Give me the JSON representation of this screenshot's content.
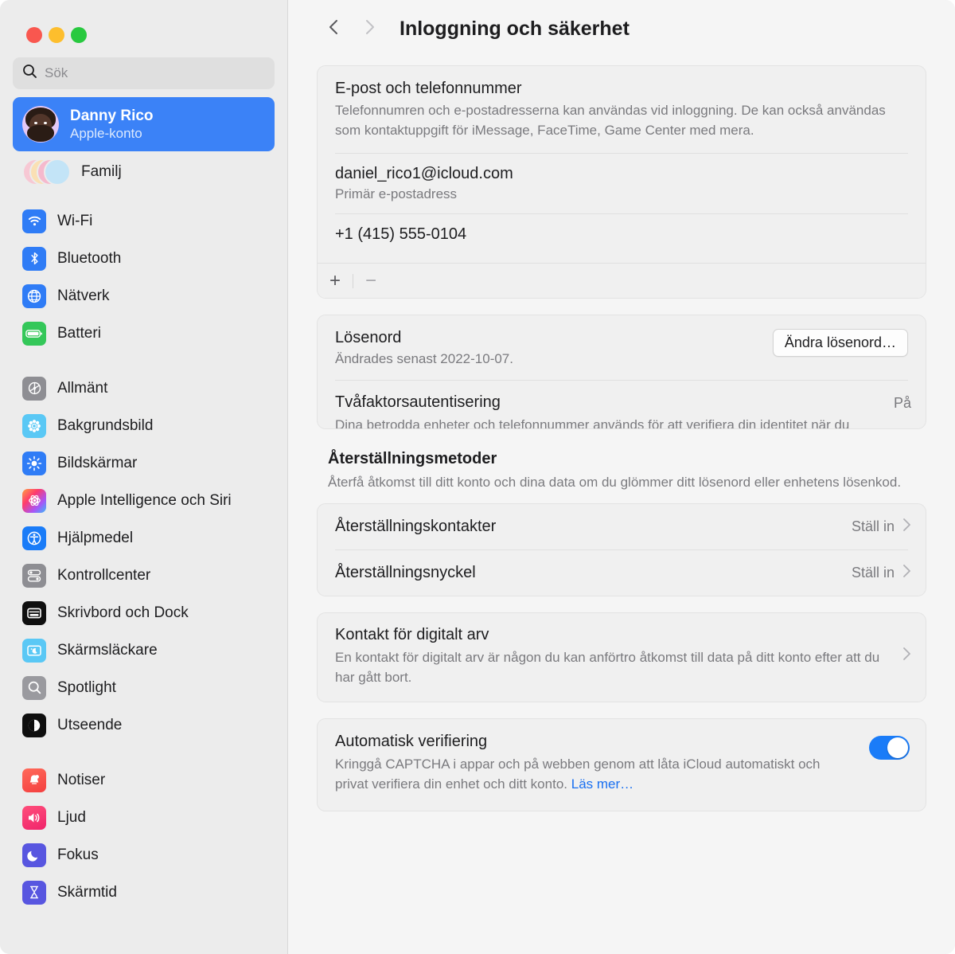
{
  "window": {
    "traffic_lights": [
      "close",
      "minimize",
      "zoom"
    ],
    "colors": {
      "close": "#f9574f",
      "minimize": "#fdbe2d",
      "zoom": "#28c93f",
      "accent": "#3b82f7",
      "link": "#186ff1",
      "toggle_on": "#1a7cf8"
    }
  },
  "sidebar": {
    "search": {
      "placeholder": "Sök",
      "value": "",
      "icon": "search-icon"
    },
    "account": {
      "name": "Danny Rico",
      "subtitle": "Apple-konto",
      "selected": true
    },
    "family": {
      "label": "Familj"
    },
    "groups": [
      {
        "items": [
          {
            "label": "Wi-Fi",
            "icon": "wifi-icon"
          },
          {
            "label": "Bluetooth",
            "icon": "bluetooth-icon"
          },
          {
            "label": "Nätverk",
            "icon": "globe-icon"
          },
          {
            "label": "Batteri",
            "icon": "battery-icon"
          }
        ]
      },
      {
        "items": [
          {
            "label": "Allmänt",
            "icon": "gear-icon"
          },
          {
            "label": "Bakgrundsbild",
            "icon": "wallpaper-icon"
          },
          {
            "label": "Bildskärmar",
            "icon": "display-brightness-icon"
          },
          {
            "label": "Apple Intelligence och Siri",
            "icon": "apple-intelligence-icon"
          },
          {
            "label": "Hjälpmedel",
            "icon": "accessibility-icon"
          },
          {
            "label": "Kontrollcenter",
            "icon": "control-center-icon"
          },
          {
            "label": "Skrivbord och Dock",
            "icon": "desktop-dock-icon"
          },
          {
            "label": "Skärmsläckare",
            "icon": "screensaver-icon"
          },
          {
            "label": "Spotlight",
            "icon": "spotlight-icon"
          },
          {
            "label": "Utseende",
            "icon": "appearance-icon"
          }
        ]
      },
      {
        "items": [
          {
            "label": "Notiser",
            "icon": "bell-icon"
          },
          {
            "label": "Ljud",
            "icon": "speaker-icon"
          },
          {
            "label": "Fokus",
            "icon": "moon-icon"
          },
          {
            "label": "Skärmtid",
            "icon": "hourglass-icon"
          }
        ]
      }
    ]
  },
  "toolbar": {
    "back_icon": "chevron-left-icon",
    "forward_icon": "chevron-right-icon",
    "title": "Inloggning och säkerhet"
  },
  "main": {
    "email_card": {
      "heading": "E-post och telefonnummer",
      "description": "Telefonnumren och e-postadresserna kan användas vid inloggning. De kan också användas som kontaktuppgift för iMessage, FaceTime, Game Center med mera.",
      "entries": [
        {
          "value": "daniel_rico1@icloud.com",
          "sub": "Primär e-postadress"
        },
        {
          "value": "+1 (415) 555-0104",
          "sub": ""
        }
      ],
      "add_label": "+",
      "remove_label": "−"
    },
    "password_card": {
      "password": {
        "heading": "Lösenord",
        "description": "Ändrades senast 2022-10-07.",
        "button_label": "Ändra lösenord…"
      },
      "two_factor": {
        "heading": "Tvåfaktorsautentisering",
        "description": "Dina betrodda enheter och telefonnummer används för att verifiera din identitet när du loggar in.",
        "status": "På"
      }
    },
    "recovery_section": {
      "heading": "Återställningsmetoder",
      "description": "Återfå åtkomst till ditt konto och dina data om du glömmer ditt lösenord eller enhetens lösenkod.",
      "rows": [
        {
          "label": "Återställningskontakter",
          "action": "Ställ in"
        },
        {
          "label": "Återställningsnyckel",
          "action": "Ställ in"
        }
      ]
    },
    "legacy_card": {
      "heading": "Kontakt för digitalt arv",
      "description": "En kontakt för digitalt arv är någon du kan anförtro åtkomst till data på ditt konto efter att du har gått bort."
    },
    "auto_verify_card": {
      "heading": "Automatisk verifiering",
      "description": "Kringgå CAPTCHA i appar och på webben genom att låta iCloud automatiskt och privat verifiera din enhet och ditt konto. ",
      "link_label": "Läs mer…",
      "enabled": true
    }
  }
}
